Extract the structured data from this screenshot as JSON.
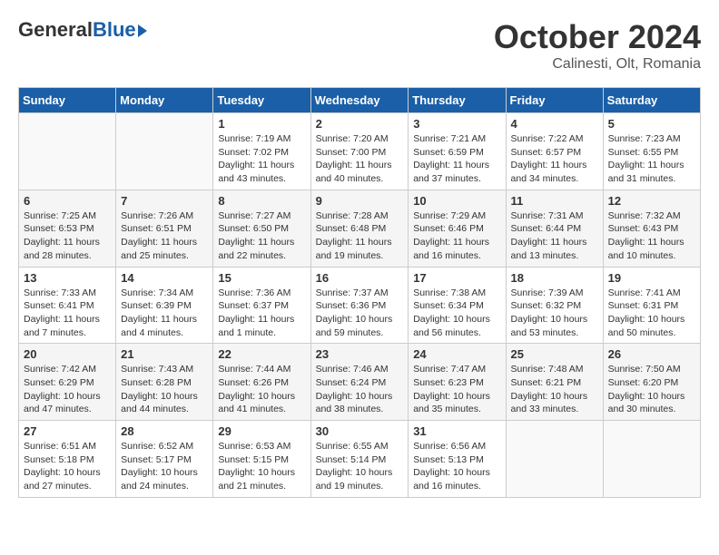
{
  "header": {
    "logo_general": "General",
    "logo_blue": "Blue",
    "month": "October 2024",
    "location": "Calinesti, Olt, Romania"
  },
  "days_of_week": [
    "Sunday",
    "Monday",
    "Tuesday",
    "Wednesday",
    "Thursday",
    "Friday",
    "Saturday"
  ],
  "weeks": [
    [
      {
        "day": "",
        "info": ""
      },
      {
        "day": "",
        "info": ""
      },
      {
        "day": "1",
        "info": "Sunrise: 7:19 AM\nSunset: 7:02 PM\nDaylight: 11 hours and 43 minutes."
      },
      {
        "day": "2",
        "info": "Sunrise: 7:20 AM\nSunset: 7:00 PM\nDaylight: 11 hours and 40 minutes."
      },
      {
        "day": "3",
        "info": "Sunrise: 7:21 AM\nSunset: 6:59 PM\nDaylight: 11 hours and 37 minutes."
      },
      {
        "day": "4",
        "info": "Sunrise: 7:22 AM\nSunset: 6:57 PM\nDaylight: 11 hours and 34 minutes."
      },
      {
        "day": "5",
        "info": "Sunrise: 7:23 AM\nSunset: 6:55 PM\nDaylight: 11 hours and 31 minutes."
      }
    ],
    [
      {
        "day": "6",
        "info": "Sunrise: 7:25 AM\nSunset: 6:53 PM\nDaylight: 11 hours and 28 minutes."
      },
      {
        "day": "7",
        "info": "Sunrise: 7:26 AM\nSunset: 6:51 PM\nDaylight: 11 hours and 25 minutes."
      },
      {
        "day": "8",
        "info": "Sunrise: 7:27 AM\nSunset: 6:50 PM\nDaylight: 11 hours and 22 minutes."
      },
      {
        "day": "9",
        "info": "Sunrise: 7:28 AM\nSunset: 6:48 PM\nDaylight: 11 hours and 19 minutes."
      },
      {
        "day": "10",
        "info": "Sunrise: 7:29 AM\nSunset: 6:46 PM\nDaylight: 11 hours and 16 minutes."
      },
      {
        "day": "11",
        "info": "Sunrise: 7:31 AM\nSunset: 6:44 PM\nDaylight: 11 hours and 13 minutes."
      },
      {
        "day": "12",
        "info": "Sunrise: 7:32 AM\nSunset: 6:43 PM\nDaylight: 11 hours and 10 minutes."
      }
    ],
    [
      {
        "day": "13",
        "info": "Sunrise: 7:33 AM\nSunset: 6:41 PM\nDaylight: 11 hours and 7 minutes."
      },
      {
        "day": "14",
        "info": "Sunrise: 7:34 AM\nSunset: 6:39 PM\nDaylight: 11 hours and 4 minutes."
      },
      {
        "day": "15",
        "info": "Sunrise: 7:36 AM\nSunset: 6:37 PM\nDaylight: 11 hours and 1 minute."
      },
      {
        "day": "16",
        "info": "Sunrise: 7:37 AM\nSunset: 6:36 PM\nDaylight: 10 hours and 59 minutes."
      },
      {
        "day": "17",
        "info": "Sunrise: 7:38 AM\nSunset: 6:34 PM\nDaylight: 10 hours and 56 minutes."
      },
      {
        "day": "18",
        "info": "Sunrise: 7:39 AM\nSunset: 6:32 PM\nDaylight: 10 hours and 53 minutes."
      },
      {
        "day": "19",
        "info": "Sunrise: 7:41 AM\nSunset: 6:31 PM\nDaylight: 10 hours and 50 minutes."
      }
    ],
    [
      {
        "day": "20",
        "info": "Sunrise: 7:42 AM\nSunset: 6:29 PM\nDaylight: 10 hours and 47 minutes."
      },
      {
        "day": "21",
        "info": "Sunrise: 7:43 AM\nSunset: 6:28 PM\nDaylight: 10 hours and 44 minutes."
      },
      {
        "day": "22",
        "info": "Sunrise: 7:44 AM\nSunset: 6:26 PM\nDaylight: 10 hours and 41 minutes."
      },
      {
        "day": "23",
        "info": "Sunrise: 7:46 AM\nSunset: 6:24 PM\nDaylight: 10 hours and 38 minutes."
      },
      {
        "day": "24",
        "info": "Sunrise: 7:47 AM\nSunset: 6:23 PM\nDaylight: 10 hours and 35 minutes."
      },
      {
        "day": "25",
        "info": "Sunrise: 7:48 AM\nSunset: 6:21 PM\nDaylight: 10 hours and 33 minutes."
      },
      {
        "day": "26",
        "info": "Sunrise: 7:50 AM\nSunset: 6:20 PM\nDaylight: 10 hours and 30 minutes."
      }
    ],
    [
      {
        "day": "27",
        "info": "Sunrise: 6:51 AM\nSunset: 5:18 PM\nDaylight: 10 hours and 27 minutes."
      },
      {
        "day": "28",
        "info": "Sunrise: 6:52 AM\nSunset: 5:17 PM\nDaylight: 10 hours and 24 minutes."
      },
      {
        "day": "29",
        "info": "Sunrise: 6:53 AM\nSunset: 5:15 PM\nDaylight: 10 hours and 21 minutes."
      },
      {
        "day": "30",
        "info": "Sunrise: 6:55 AM\nSunset: 5:14 PM\nDaylight: 10 hours and 19 minutes."
      },
      {
        "day": "31",
        "info": "Sunrise: 6:56 AM\nSunset: 5:13 PM\nDaylight: 10 hours and 16 minutes."
      },
      {
        "day": "",
        "info": ""
      },
      {
        "day": "",
        "info": ""
      }
    ]
  ]
}
